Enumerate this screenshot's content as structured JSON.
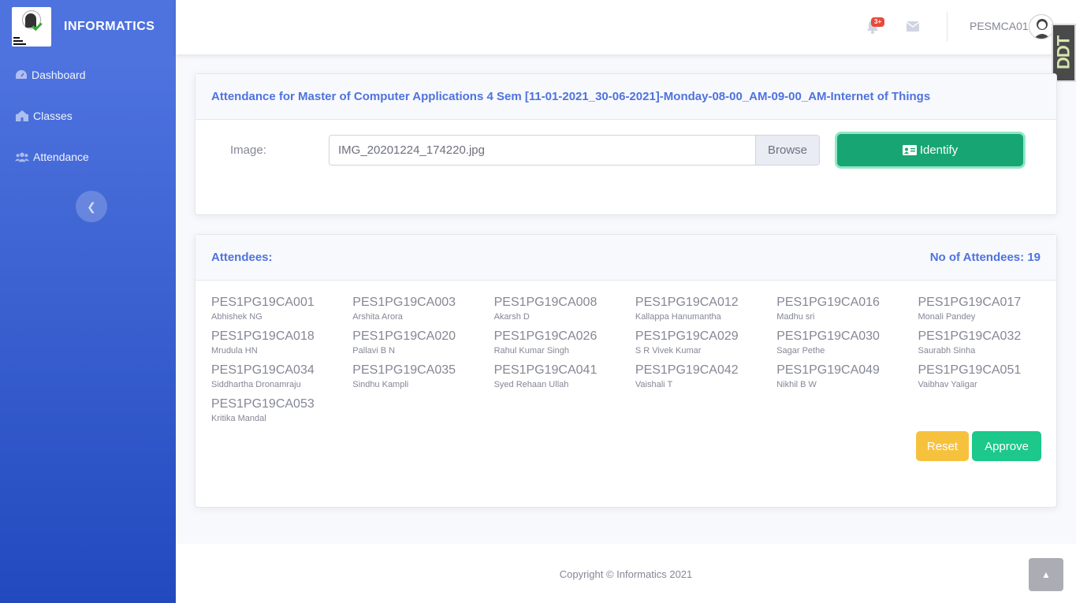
{
  "sidebar": {
    "brand": "INFORMATICS",
    "items": [
      {
        "label": "Dashboard",
        "icon": "tachometer-icon"
      },
      {
        "label": "Classes",
        "icon": "school-icon"
      },
      {
        "label": "Attendance",
        "icon": "users-icon"
      }
    ],
    "toggle_icon": "chevron-left-icon"
  },
  "topbar": {
    "notification_count": "3+",
    "username": "PESMCA01",
    "corner_badge": "DDT"
  },
  "form_card": {
    "title": "Attendance for Master of Computer Applications 4 Sem [11-01-2021_30-06-2021]-Monday-08-00_AM-09-00_AM-Internet of Things",
    "image_label": "Image:",
    "file_value": "IMG_20201224_174220.jpg",
    "browse_label": "Browse",
    "identify_label": "Identify"
  },
  "attendees_card": {
    "title": "Attendees:",
    "count_label": "No of Attendees: 19",
    "attendees": [
      {
        "usn": "PES1PG19CA001",
        "name": "Abhishek NG"
      },
      {
        "usn": "PES1PG19CA003",
        "name": "Arshita Arora"
      },
      {
        "usn": "PES1PG19CA008",
        "name": "Akarsh D"
      },
      {
        "usn": "PES1PG19CA012",
        "name": "Kallappa Hanumantha"
      },
      {
        "usn": "PES1PG19CA016",
        "name": "Madhu sri"
      },
      {
        "usn": "PES1PG19CA017",
        "name": "Monali Pandey"
      },
      {
        "usn": "PES1PG19CA018",
        "name": "Mrudula HN"
      },
      {
        "usn": "PES1PG19CA020",
        "name": "Pallavi B N"
      },
      {
        "usn": "PES1PG19CA026",
        "name": "Rahul Kumar Singh"
      },
      {
        "usn": "PES1PG19CA029",
        "name": "S R Vivek Kumar"
      },
      {
        "usn": "PES1PG19CA030",
        "name": "Sagar Pethe"
      },
      {
        "usn": "PES1PG19CA032",
        "name": "Saurabh Sinha"
      },
      {
        "usn": "PES1PG19CA034",
        "name": "Siddhartha Dronamraju"
      },
      {
        "usn": "PES1PG19CA035",
        "name": "Sindhu Kampli"
      },
      {
        "usn": "PES1PG19CA041",
        "name": "Syed Rehaan Ullah"
      },
      {
        "usn": "PES1PG19CA042",
        "name": "Vaishali T"
      },
      {
        "usn": "PES1PG19CA049",
        "name": "Nikhil B W"
      },
      {
        "usn": "PES1PG19CA051",
        "name": "Vaibhav Yaligar"
      },
      {
        "usn": "PES1PG19CA053",
        "name": "Kritika Mandal"
      }
    ],
    "reset_label": "Reset",
    "approve_label": "Approve"
  },
  "footer": {
    "copyright": "Copyright © Informatics 2021"
  },
  "colors": {
    "primary": "#4e73df",
    "success": "#1cc88a",
    "warning": "#f6c23e",
    "danger": "#e74a3b"
  }
}
